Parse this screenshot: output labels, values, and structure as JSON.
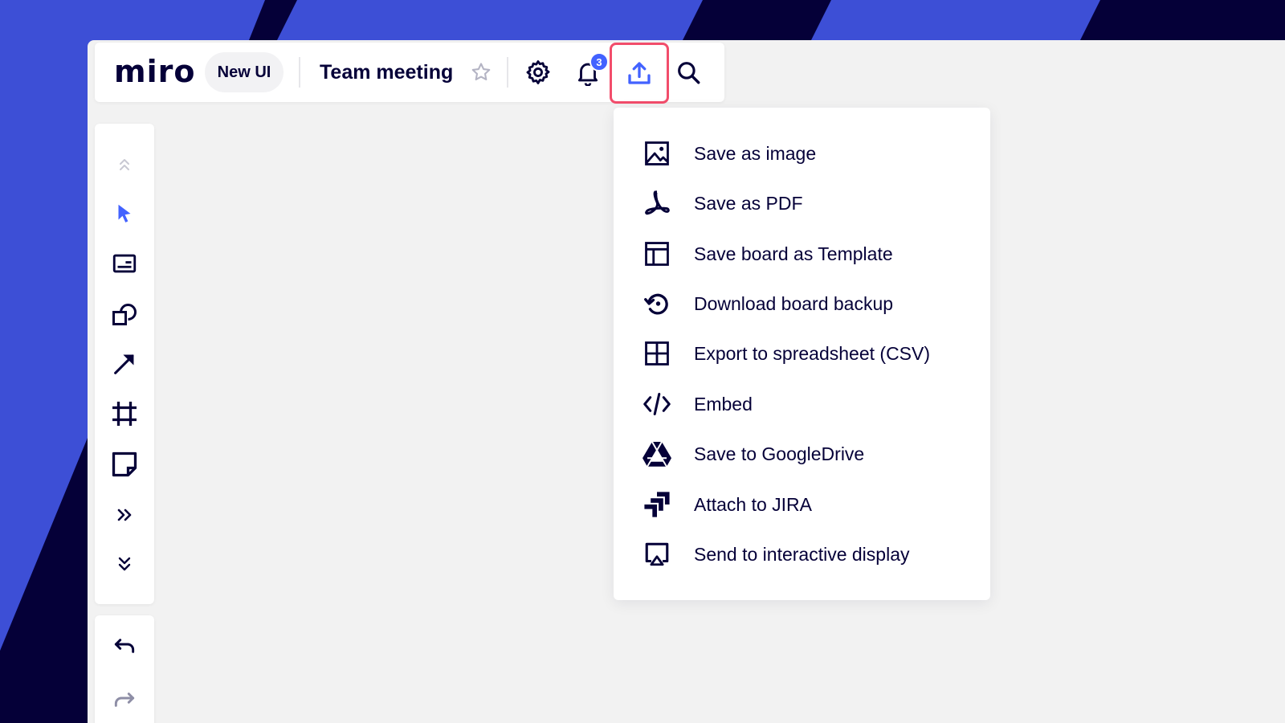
{
  "app": {
    "logo_text": "miro",
    "ui_badge": "New UI",
    "board_title": "Team meeting"
  },
  "topbar": {
    "icons": [
      "star-icon",
      "gear-icon",
      "bell-icon",
      "export-icon",
      "search-icon"
    ],
    "notification_count": "3"
  },
  "toolbar": {
    "tools": [
      "collapse-up-icon",
      "select-cursor-icon",
      "text-icon",
      "shapes-icon",
      "arrow-line-icon",
      "frame-icon",
      "sticky-note-icon",
      "more-tools-icon",
      "expand-down-icon"
    ],
    "history": [
      "undo-icon",
      "redo-icon"
    ]
  },
  "export_menu": {
    "items": [
      {
        "label": "Save as image",
        "icon": "image-icon"
      },
      {
        "label": "Save as PDF",
        "icon": "pdf-icon"
      },
      {
        "label": "Save board as Template",
        "icon": "template-icon"
      },
      {
        "label": "Download board backup",
        "icon": "backup-icon"
      },
      {
        "label": "Export to spreadsheet (CSV)",
        "icon": "spreadsheet-icon"
      },
      {
        "label": "Embed",
        "icon": "embed-code-icon"
      },
      {
        "label": "Save to GoogleDrive",
        "icon": "google-drive-icon"
      },
      {
        "label": "Attach to JIRA",
        "icon": "jira-icon"
      },
      {
        "label": "Send to interactive display",
        "icon": "airplay-display-icon"
      }
    ]
  },
  "colors": {
    "brand_blue": "#3d4fd6",
    "dark_navy": "#050038",
    "canvas_bg": "#f2f2f2",
    "accent_blue": "#4262ff",
    "highlight_red": "#f24d6b"
  }
}
